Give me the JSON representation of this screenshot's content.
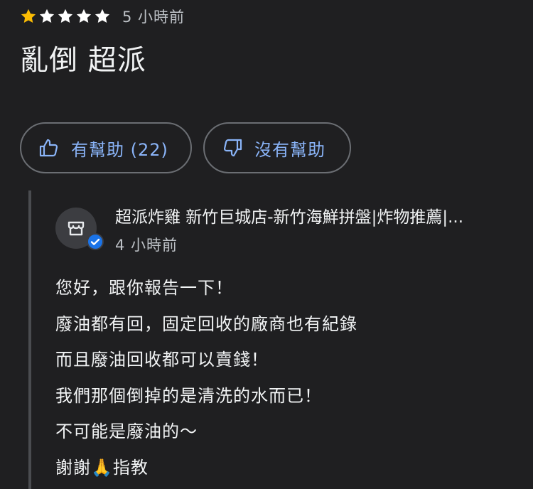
{
  "review": {
    "rating": 1,
    "max_rating": 5,
    "time": "5 小時前",
    "text": "亂倒 超派",
    "helpful_label": "有幫助 (22)",
    "unhelpful_label": "沒有幫助"
  },
  "reply": {
    "owner_name": "超派炸雞 新竹巨城店-新竹海鮮拼盤|炸物推薦|...",
    "time": "4 小時前",
    "lines": [
      "您好，跟你報告一下！",
      "廢油都有回，固定回收的廠商也有紀錄",
      "而且廢油回收都可以賣錢！",
      "我們那個倒掉的是清洗的水而已！",
      "不可能是廢油的～",
      "謝謝🙏指教"
    ]
  },
  "colors": {
    "background": "#1f1f21",
    "star_filled": "#fbbc04",
    "star_empty": "#ffffff",
    "link_blue": "#8ab4f8",
    "verified_blue": "#1a73e8"
  },
  "icons": {
    "star": "star-icon",
    "thumbs_up": "thumbs-up-icon",
    "thumbs_down": "thumbs-down-icon",
    "store": "store-icon",
    "verified": "verified-check-icon"
  }
}
